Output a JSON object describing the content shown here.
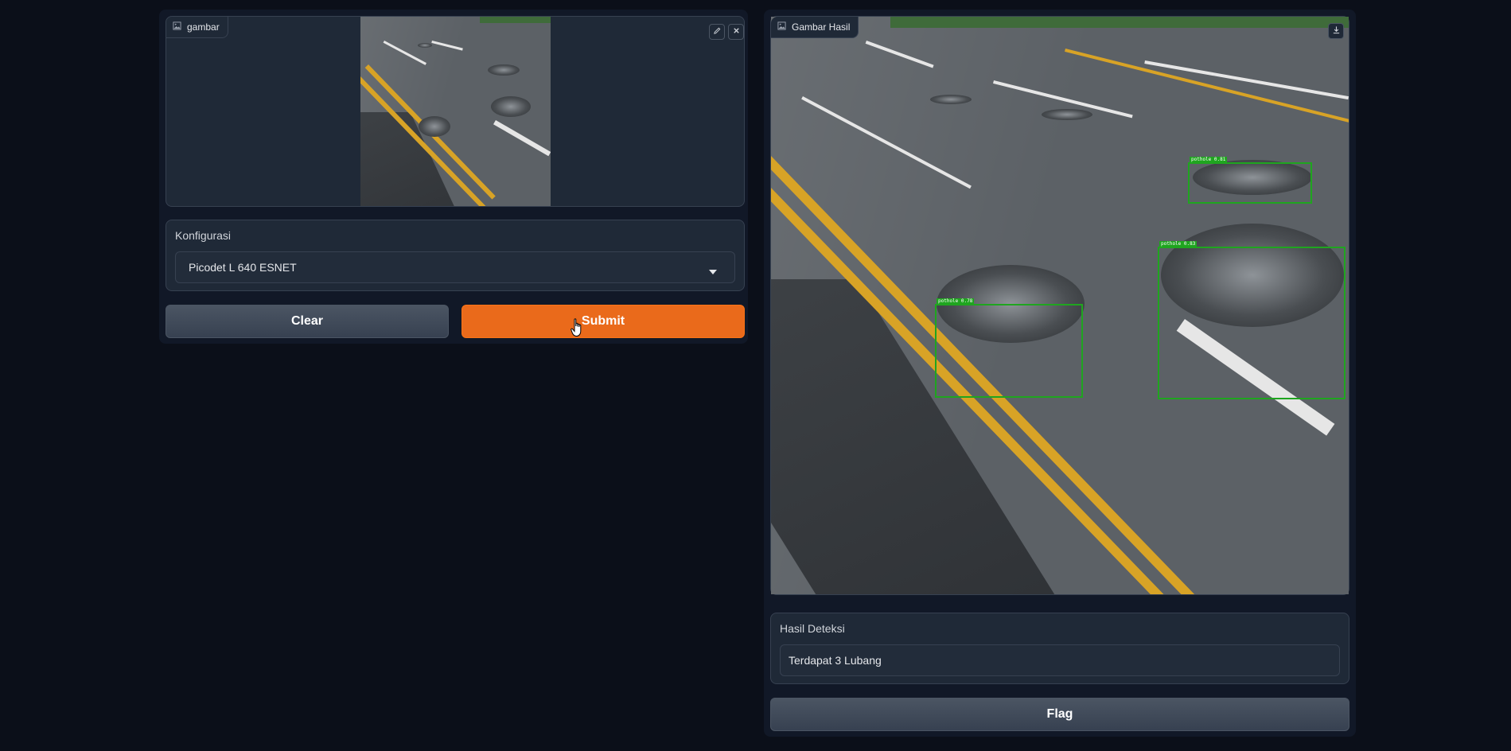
{
  "input_image": {
    "label": "gambar",
    "icon": "image-icon",
    "edit_icon": "pencil-icon",
    "close_icon": "close-icon"
  },
  "config": {
    "label": "Konfigurasi",
    "selected": "Picodet L 640 ESNET",
    "dropdown_icon": "caret-down-icon"
  },
  "actions": {
    "clear_label": "Clear",
    "submit_label": "Submit"
  },
  "output_image": {
    "label": "Gambar Hasil",
    "icon": "image-icon",
    "download_icon": "download-icon",
    "detections": [
      {
        "label": "pothole 0.81"
      },
      {
        "label": "pothole 0.83"
      },
      {
        "label": "pothole 0.78"
      }
    ]
  },
  "result": {
    "label": "Hasil Deteksi",
    "value": "Terdapat 3 Lubang"
  },
  "flag": {
    "label": "Flag"
  },
  "colors": {
    "background": "#0b0f19",
    "panel": "#1f2937",
    "primary": "#ea6a1b",
    "detection_box": "#1fa51f"
  }
}
